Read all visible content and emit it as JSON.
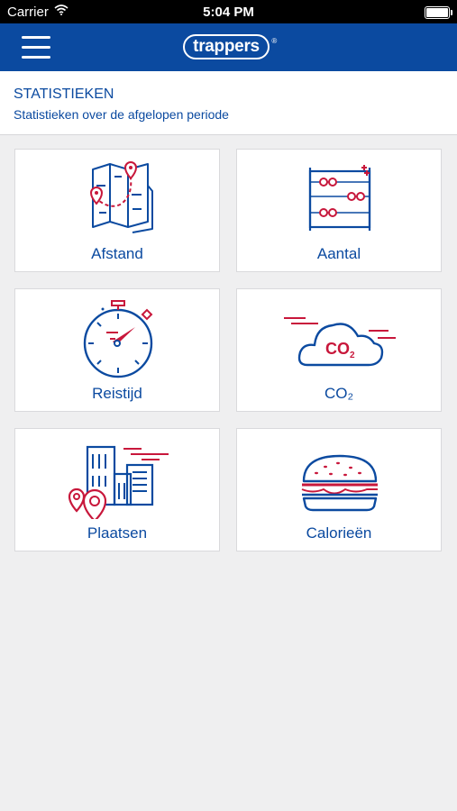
{
  "status_bar": {
    "carrier": "Carrier",
    "time": "5:04 PM"
  },
  "nav": {
    "logo_text": "trappers",
    "logo_mark": "®",
    "menu_icon": "hamburger-icon"
  },
  "header": {
    "title": "STATISTIEKEN",
    "subtitle": "Statistieken over de afgelopen periode"
  },
  "tiles": [
    {
      "label": "Afstand",
      "icon": "map-route-icon"
    },
    {
      "label": "Aantal",
      "icon": "abacus-icon"
    },
    {
      "label": "Reistijd",
      "icon": "stopwatch-icon"
    },
    {
      "label": "CO₂",
      "icon": "co2-cloud-icon",
      "icon_text": "CO",
      "icon_sub": "2"
    },
    {
      "label": "Plaatsen",
      "icon": "city-pin-icon"
    },
    {
      "label": "Calorieën",
      "icon": "burger-icon"
    }
  ],
  "colors": {
    "brand_blue": "#0b4aa0",
    "accent_red": "#c8173b",
    "background": "#efeff0"
  }
}
